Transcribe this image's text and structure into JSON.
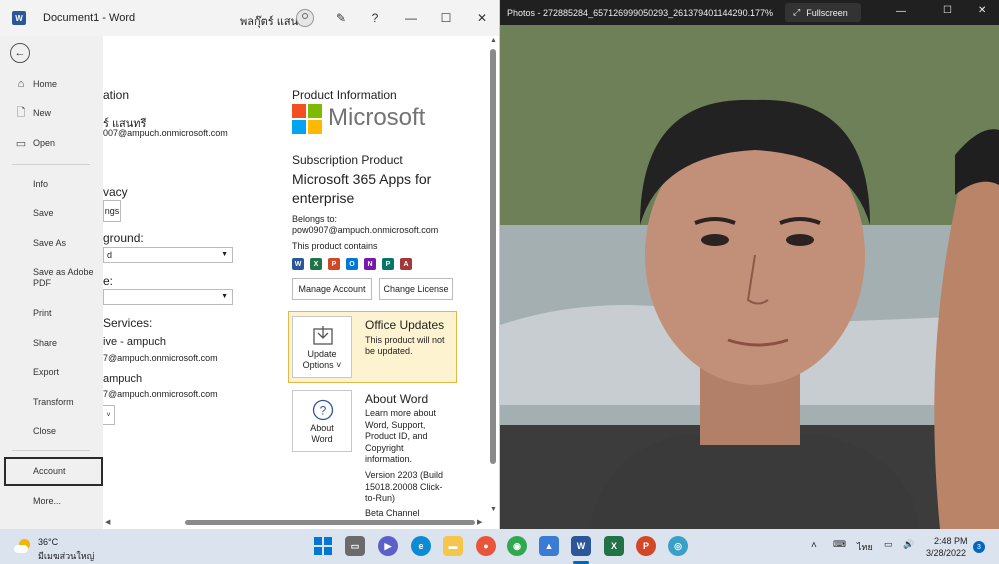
{
  "word": {
    "title": "Document1  -  Word",
    "user_name": "พลกุ๊ตร์ แสนทรี",
    "backstage": {
      "items": [
        {
          "label": "Home",
          "icon": "home-icon"
        },
        {
          "label": "New",
          "icon": "new-document-icon"
        },
        {
          "label": "Open",
          "icon": "folder-open-icon"
        },
        {
          "label": "Info"
        },
        {
          "label": "Save"
        },
        {
          "label": "Save As"
        },
        {
          "label": "Save as Adobe PDF"
        },
        {
          "label": "Print"
        },
        {
          "label": "Share"
        },
        {
          "label": "Export"
        },
        {
          "label": "Transform"
        },
        {
          "label": "Close"
        },
        {
          "label": "Account"
        },
        {
          "label": "More..."
        }
      ]
    },
    "account": {
      "user_info_heading": "ation",
      "user_name": "ร์ แสนทรี",
      "user_email": "007@ampuch.onmicrosoft.com",
      "privacy_heading": "vacy",
      "privacy_button": "ngs",
      "background_label": "ground:",
      "background_value": "d",
      "theme_label": "e:",
      "theme_value": "",
      "services_heading": "Services:",
      "service1_name": "ive - ampuch",
      "service1_email": "7@ampuch.onmicrosoft.com",
      "service2_name": "ampuch",
      "service2_email": "7@ampuch.onmicrosoft.com"
    },
    "product": {
      "heading": "Product Information",
      "logo_text": "Microsoft",
      "subscription_heading": "Subscription Product",
      "product_name_line1": "Microsoft 365 Apps for",
      "product_name_line2": "enterprise",
      "belongs_to_label": "Belongs to:",
      "belongs_to_email": "pow0907@ampuch.onmicrosoft.com",
      "contains_label": "This product contains",
      "apps": [
        {
          "letter": "W",
          "color": "#2b579a"
        },
        {
          "letter": "X",
          "color": "#217346"
        },
        {
          "letter": "P",
          "color": "#d24726"
        },
        {
          "letter": "O",
          "color": "#0078d4"
        },
        {
          "letter": "N",
          "color": "#7719aa"
        },
        {
          "letter": "P",
          "color": "#077568"
        },
        {
          "letter": "A",
          "color": "#a4373a"
        }
      ],
      "manage_account": "Manage Account",
      "change_license": "Change License",
      "updates_heading": "Office Updates",
      "updates_text": "This product will not be updated.",
      "update_options_line1": "Update",
      "update_options_line2": "Options ˅",
      "about_heading": "About Word",
      "about_text": "Learn more about Word, Support, Product ID, and Copyright information.",
      "version_text": "Version 2203 (Build 15018.20008 Click-to-Run)",
      "channel_text": "Beta Channel",
      "about_button_line1": "About",
      "about_button_line2": "Word"
    }
  },
  "photos": {
    "title": "Photos - 272885284_657126999050293_261379401144290...",
    "zoom": "177%",
    "fullscreen_label": "Fullscreen"
  },
  "taskbar": {
    "weather_temp": "36°C",
    "weather_desc": "มีเมฆส่วนใหญ่",
    "language": "ไทย",
    "time": "2:48 PM",
    "date": "3/28/2022",
    "notification_count": "3"
  },
  "colors": {
    "word_blue": "#2b579a",
    "update_card_bg": "#fdf3d0",
    "update_card_border": "#e0b84a"
  }
}
